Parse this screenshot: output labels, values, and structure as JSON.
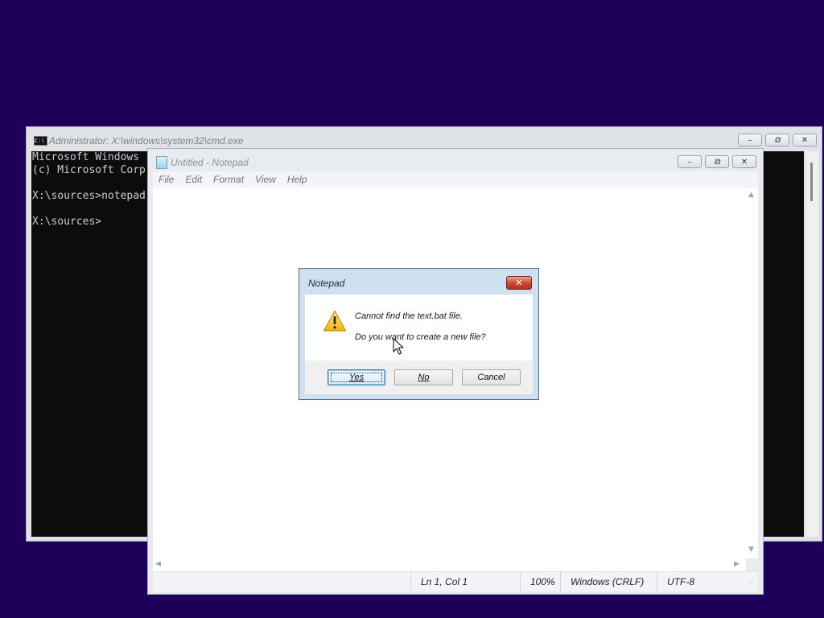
{
  "cmd": {
    "title": "Administrator: X:\\windows\\system32\\cmd.exe",
    "icon_text": "C:\\",
    "lines": [
      "Microsoft Windows",
      "(c) Microsoft Corp",
      "",
      "X:\\sources>notepad",
      "",
      "X:\\sources>"
    ]
  },
  "notepad": {
    "title": "Untitled - Notepad",
    "menu": [
      "File",
      "Edit",
      "Format",
      "View",
      "Help"
    ],
    "status": {
      "position": "Ln 1, Col 1",
      "zoom": "100%",
      "line_ending": "Windows (CRLF)",
      "encoding": "UTF-8"
    }
  },
  "dialog": {
    "title": "Notepad",
    "message_line1": "Cannot find the text.bat file.",
    "message_line2": "Do you want to create a new file?",
    "buttons": {
      "yes": "Yes",
      "no": "No",
      "cancel": "Cancel"
    },
    "icon": "warning-triangle-icon"
  },
  "colors": {
    "desktop": "#1e0059",
    "close_button": "#c9462f",
    "warning": "#f3c221"
  }
}
